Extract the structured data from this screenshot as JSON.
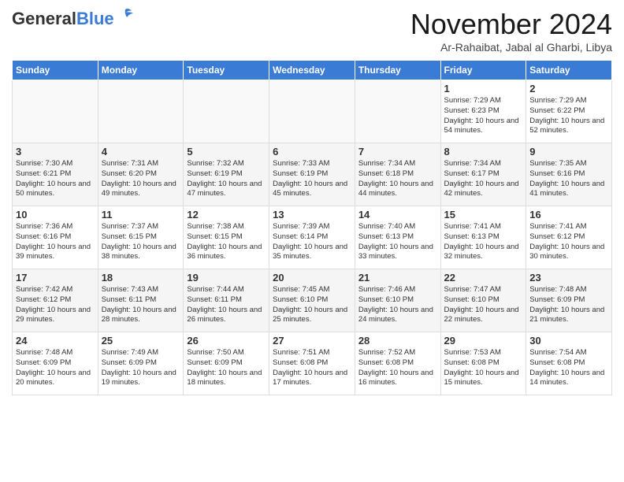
{
  "header": {
    "logo_general": "General",
    "logo_blue": "Blue",
    "month_title": "November 2024",
    "subtitle": "Ar-Rahaibat, Jabal al Gharbi, Libya"
  },
  "days_of_week": [
    "Sunday",
    "Monday",
    "Tuesday",
    "Wednesday",
    "Thursday",
    "Friday",
    "Saturday"
  ],
  "weeks": [
    [
      {
        "day": "",
        "info": ""
      },
      {
        "day": "",
        "info": ""
      },
      {
        "day": "",
        "info": ""
      },
      {
        "day": "",
        "info": ""
      },
      {
        "day": "",
        "info": ""
      },
      {
        "day": "1",
        "info": "Sunrise: 7:29 AM\nSunset: 6:23 PM\nDaylight: 10 hours and 54 minutes."
      },
      {
        "day": "2",
        "info": "Sunrise: 7:29 AM\nSunset: 6:22 PM\nDaylight: 10 hours and 52 minutes."
      }
    ],
    [
      {
        "day": "3",
        "info": "Sunrise: 7:30 AM\nSunset: 6:21 PM\nDaylight: 10 hours and 50 minutes."
      },
      {
        "day": "4",
        "info": "Sunrise: 7:31 AM\nSunset: 6:20 PM\nDaylight: 10 hours and 49 minutes."
      },
      {
        "day": "5",
        "info": "Sunrise: 7:32 AM\nSunset: 6:19 PM\nDaylight: 10 hours and 47 minutes."
      },
      {
        "day": "6",
        "info": "Sunrise: 7:33 AM\nSunset: 6:19 PM\nDaylight: 10 hours and 45 minutes."
      },
      {
        "day": "7",
        "info": "Sunrise: 7:34 AM\nSunset: 6:18 PM\nDaylight: 10 hours and 44 minutes."
      },
      {
        "day": "8",
        "info": "Sunrise: 7:34 AM\nSunset: 6:17 PM\nDaylight: 10 hours and 42 minutes."
      },
      {
        "day": "9",
        "info": "Sunrise: 7:35 AM\nSunset: 6:16 PM\nDaylight: 10 hours and 41 minutes."
      }
    ],
    [
      {
        "day": "10",
        "info": "Sunrise: 7:36 AM\nSunset: 6:16 PM\nDaylight: 10 hours and 39 minutes."
      },
      {
        "day": "11",
        "info": "Sunrise: 7:37 AM\nSunset: 6:15 PM\nDaylight: 10 hours and 38 minutes."
      },
      {
        "day": "12",
        "info": "Sunrise: 7:38 AM\nSunset: 6:15 PM\nDaylight: 10 hours and 36 minutes."
      },
      {
        "day": "13",
        "info": "Sunrise: 7:39 AM\nSunset: 6:14 PM\nDaylight: 10 hours and 35 minutes."
      },
      {
        "day": "14",
        "info": "Sunrise: 7:40 AM\nSunset: 6:13 PM\nDaylight: 10 hours and 33 minutes."
      },
      {
        "day": "15",
        "info": "Sunrise: 7:41 AM\nSunset: 6:13 PM\nDaylight: 10 hours and 32 minutes."
      },
      {
        "day": "16",
        "info": "Sunrise: 7:41 AM\nSunset: 6:12 PM\nDaylight: 10 hours and 30 minutes."
      }
    ],
    [
      {
        "day": "17",
        "info": "Sunrise: 7:42 AM\nSunset: 6:12 PM\nDaylight: 10 hours and 29 minutes."
      },
      {
        "day": "18",
        "info": "Sunrise: 7:43 AM\nSunset: 6:11 PM\nDaylight: 10 hours and 28 minutes."
      },
      {
        "day": "19",
        "info": "Sunrise: 7:44 AM\nSunset: 6:11 PM\nDaylight: 10 hours and 26 minutes."
      },
      {
        "day": "20",
        "info": "Sunrise: 7:45 AM\nSunset: 6:10 PM\nDaylight: 10 hours and 25 minutes."
      },
      {
        "day": "21",
        "info": "Sunrise: 7:46 AM\nSunset: 6:10 PM\nDaylight: 10 hours and 24 minutes."
      },
      {
        "day": "22",
        "info": "Sunrise: 7:47 AM\nSunset: 6:10 PM\nDaylight: 10 hours and 22 minutes."
      },
      {
        "day": "23",
        "info": "Sunrise: 7:48 AM\nSunset: 6:09 PM\nDaylight: 10 hours and 21 minutes."
      }
    ],
    [
      {
        "day": "24",
        "info": "Sunrise: 7:48 AM\nSunset: 6:09 PM\nDaylight: 10 hours and 20 minutes."
      },
      {
        "day": "25",
        "info": "Sunrise: 7:49 AM\nSunset: 6:09 PM\nDaylight: 10 hours and 19 minutes."
      },
      {
        "day": "26",
        "info": "Sunrise: 7:50 AM\nSunset: 6:09 PM\nDaylight: 10 hours and 18 minutes."
      },
      {
        "day": "27",
        "info": "Sunrise: 7:51 AM\nSunset: 6:08 PM\nDaylight: 10 hours and 17 minutes."
      },
      {
        "day": "28",
        "info": "Sunrise: 7:52 AM\nSunset: 6:08 PM\nDaylight: 10 hours and 16 minutes."
      },
      {
        "day": "29",
        "info": "Sunrise: 7:53 AM\nSunset: 6:08 PM\nDaylight: 10 hours and 15 minutes."
      },
      {
        "day": "30",
        "info": "Sunrise: 7:54 AM\nSunset: 6:08 PM\nDaylight: 10 hours and 14 minutes."
      }
    ]
  ]
}
